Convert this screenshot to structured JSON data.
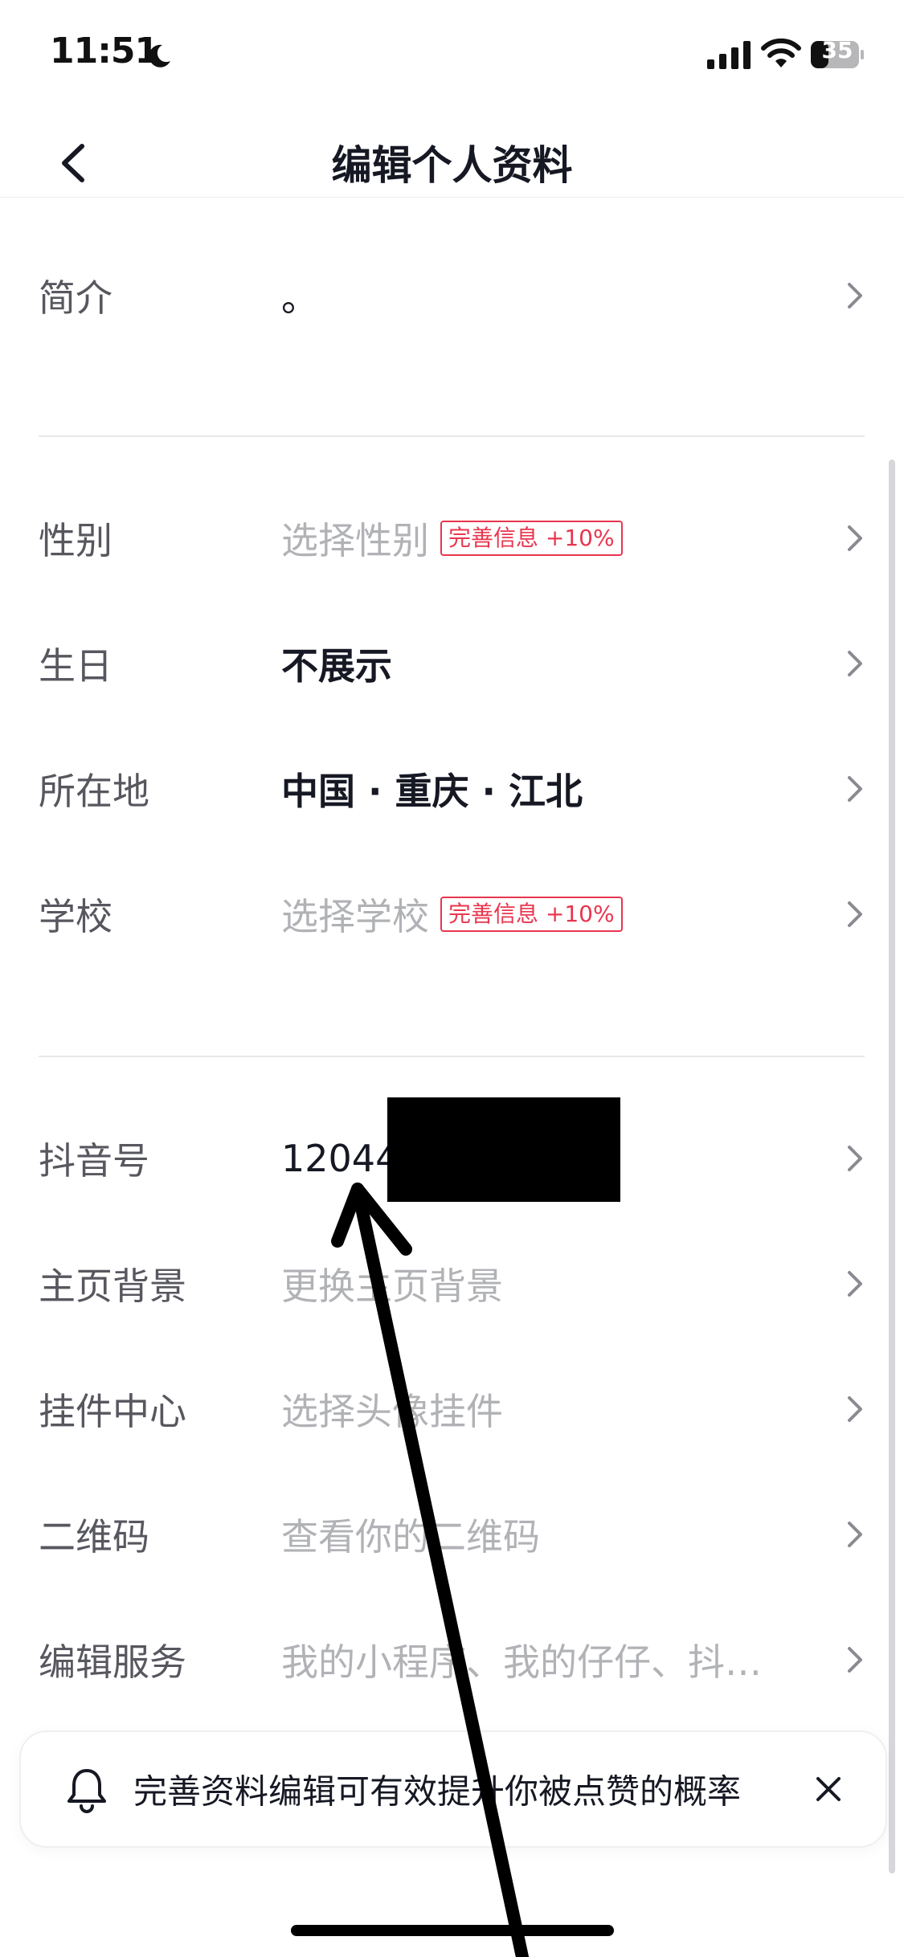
{
  "status_bar": {
    "time": "11:51",
    "battery": "35"
  },
  "header": {
    "title": "编辑个人资料"
  },
  "rows": [
    {
      "label": "简介",
      "value": "。"
    },
    {
      "label": "性别",
      "value": "选择性别",
      "badge": "完善信息 +10%"
    },
    {
      "label": "生日",
      "value": "不展示"
    },
    {
      "label": "所在地",
      "value": "中国 · 重庆 · 江北"
    },
    {
      "label": "学校",
      "value": "选择学校",
      "badge": "完善信息 +10%"
    },
    {
      "label": "抖音号",
      "value": "12044"
    },
    {
      "label": "主页背景",
      "value": "更换主页背景"
    },
    {
      "label": "挂件中心",
      "value": "选择头像挂件"
    },
    {
      "label": "二维码",
      "value": "查看你的二维码"
    },
    {
      "label": "编辑服务",
      "value": "我的小程序、我的仔仔、抖…"
    }
  ],
  "tip": {
    "text": "完善资料编辑可有效提升你被点赞的概率"
  },
  "colors": {
    "badge": "#e8364e",
    "placeholder": "#b1b2b6",
    "label": "#57575f",
    "text": "#161823"
  },
  "icons": [
    "moon-icon",
    "signal-icon",
    "wifi-icon",
    "battery-icon",
    "back-arrow-icon",
    "chevron-right-icon",
    "bell-icon",
    "close-icon"
  ]
}
